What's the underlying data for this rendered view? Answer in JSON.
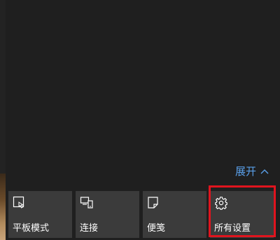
{
  "action_center": {
    "expand_label": "展开",
    "expand_icon": "chevron-up-icon",
    "accent_color": "#5aa0ea",
    "quick_actions": [
      {
        "label": "平板模式",
        "icon": "tablet-mode-icon"
      },
      {
        "label": "连接",
        "icon": "connect-icon"
      },
      {
        "label": "便笺",
        "icon": "note-icon"
      },
      {
        "label": "所有设置",
        "icon": "gear-icon"
      }
    ],
    "highlight_color": "#e0141e"
  }
}
